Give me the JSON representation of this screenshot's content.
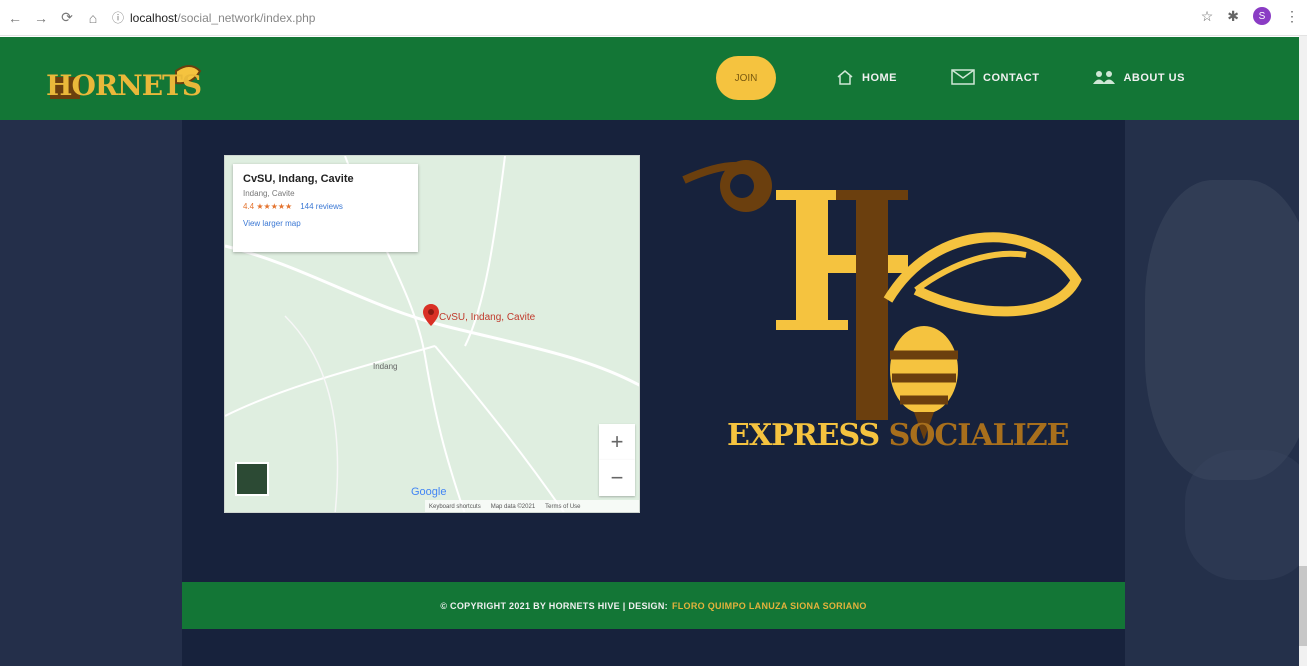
{
  "browser": {
    "back": "←",
    "forward": "→",
    "reload": "⟳",
    "home": "⌂",
    "info": "ⓘ",
    "host": "localhost",
    "path": "/social_network/index.php",
    "star": "☆",
    "ext": "✱",
    "profile": "S",
    "menu": "⋮"
  },
  "nav": {
    "logo_text": "HORNETS",
    "pill_label": "JOIN",
    "items": [
      {
        "label": "HOME",
        "icon": "home-icon"
      },
      {
        "label": "CONTACT",
        "icon": "mail-icon"
      },
      {
        "label": "ABOUT US",
        "icon": "users-icon"
      }
    ]
  },
  "map": {
    "place_title": "CvSU, Indang, Cavite",
    "place_sub": "Indang, Cavite",
    "rating": "4.4 ★★★★★",
    "reviews": "144 reviews",
    "view_larger": "View larger map",
    "pin_label": "CvSU, Indang, Cavite",
    "town_label": "Indang",
    "zoom_in": "+",
    "zoom_out": "−",
    "google": "Google",
    "footer_shortcuts": "Keyboard shortcuts",
    "footer_data": "Map data ©2021",
    "footer_terms": "Terms of Use"
  },
  "hero": {
    "tagline_a": "EXPRESS",
    "tagline_b": "SOCIALIZE"
  },
  "footer": {
    "copyright": "© COPYRIGHT 2021 BY HORNETS HIVE | DESIGN:",
    "designers": "FLORO QUIMPO LANUZA SIONA SORIANO"
  },
  "colors": {
    "nav_green": "#137636",
    "accent_yellow": "#f5c33f",
    "brown": "#6b3f0e",
    "bg_dark": "#17223c"
  }
}
